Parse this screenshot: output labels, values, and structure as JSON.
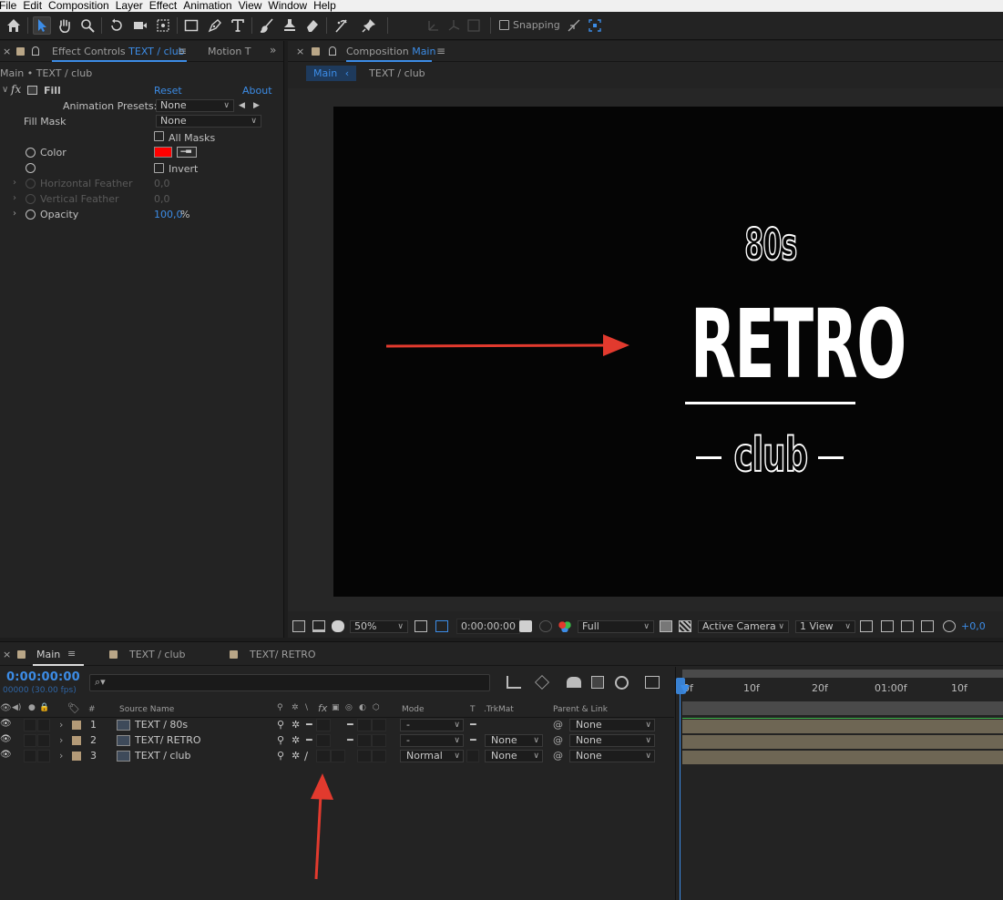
{
  "menu": [
    "File",
    "Edit",
    "Composition",
    "Layer",
    "Effect",
    "Animation",
    "View",
    "Window",
    "Help"
  ],
  "toolbar": {
    "snapping_label": "Snapping",
    "tools": [
      "home-icon",
      "selection-tool-icon",
      "hand-tool-icon",
      "zoom-tool-icon",
      "rotate-tool-icon",
      "camera-tool-icon",
      "pan-behind-tool-icon",
      "rectangle-tool-icon",
      "pen-tool-icon",
      "type-tool-icon",
      "brush-tool-icon",
      "clone-stamp-tool-icon",
      "eraser-tool-icon",
      "roto-brush-tool-icon",
      "puppet-pin-tool-icon"
    ]
  },
  "effect_controls": {
    "tab_prefix": "Effect Controls",
    "tab_layer": "TEXT / club",
    "second_tab": "Motion T",
    "breadcrumb": "Main • TEXT / club",
    "effect_name": "Fill",
    "reset": "Reset",
    "about": "About",
    "animation_presets_label": "Animation Presets:",
    "animation_presets_value": "None",
    "fill_mask_label": "Fill Mask",
    "fill_mask_value": "None",
    "all_masks_label": "All Masks",
    "color_label": "Color",
    "color_value": "#ff0000",
    "invert_label": "Invert",
    "horizontal_feather_label": "Horizontal Feather",
    "horizontal_feather_value": "0,0",
    "vertical_feather_label": "Vertical Feather",
    "vertical_feather_value": "0,0",
    "opacity_label": "Opacity",
    "opacity_value": "100,0",
    "opacity_unit": "%"
  },
  "composition": {
    "tab_prefix": "Composition",
    "tab_name": "Main",
    "nav_current": "Main",
    "nav_layer": "TEXT / club",
    "canvas_text_top": "80s",
    "canvas_text_main": "RETRO",
    "canvas_text_bottom": "club",
    "zoom": "50%",
    "timecode": "0:00:00:00",
    "resolution": "Full",
    "camera": "Active Camera",
    "views": "1 View",
    "exposure": "+0,0"
  },
  "timeline": {
    "tab_main": "Main",
    "tab_2": "TEXT / club",
    "tab_3": "TEXT/ RETRO",
    "current_time": "0:00:00:00",
    "fps_label": "00000 (30.00 fps)",
    "headers": {
      "number": "#",
      "source_name": "Source Name",
      "mode": "Mode",
      "t": "T",
      "trkmat": ".TrkMat",
      "parent": "Parent & Link"
    },
    "layers": [
      {
        "num": "1",
        "name": "TEXT / 80s",
        "mode": "-",
        "trkmat": "",
        "parent": "None"
      },
      {
        "num": "2",
        "name": "TEXT/ RETRO",
        "mode": "-",
        "trkmat": "None",
        "parent": "None"
      },
      {
        "num": "3",
        "name": "TEXT / club",
        "mode": "Normal",
        "trkmat": "None",
        "parent": "None"
      }
    ],
    "ruler_labels": [
      "0f",
      "10f",
      "20f",
      "01:00f",
      "10f"
    ]
  },
  "colors": {
    "accent_blue": "#3c8ce6",
    "annotation_red": "#e23a2e",
    "layer_label": "#b39a77",
    "fill_color": "#ff0000"
  }
}
